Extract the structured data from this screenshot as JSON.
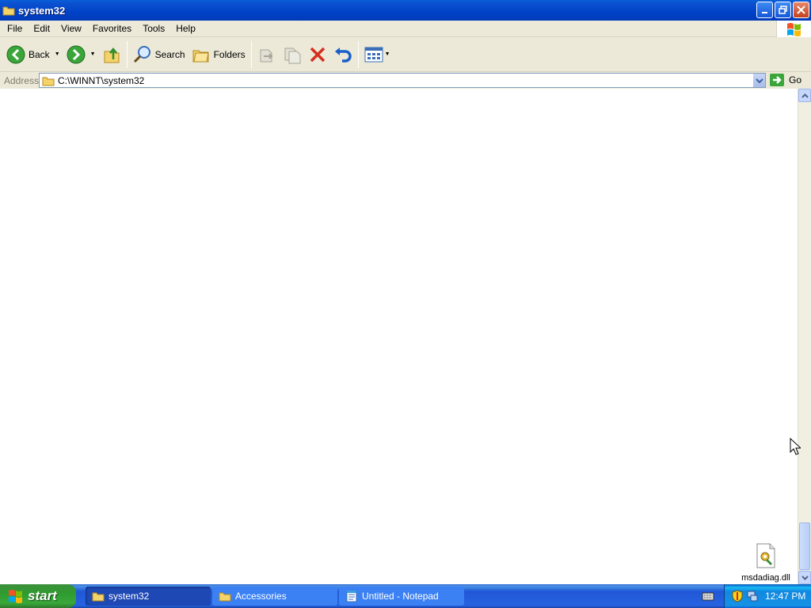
{
  "window": {
    "title": "system32"
  },
  "menubar": {
    "items": [
      "File",
      "Edit",
      "View",
      "Favorites",
      "Tools",
      "Help"
    ]
  },
  "toolbar": {
    "back_label": "Back",
    "search_label": "Search",
    "folders_label": "Folders"
  },
  "address": {
    "label": "Address",
    "value": "C:\\WINNT\\system32",
    "go_label": "Go"
  },
  "content": {
    "files": [
      {
        "name": "msdadiag.dll"
      }
    ]
  },
  "taskbar": {
    "start_label": "start",
    "tasks": [
      {
        "label": "system32"
      },
      {
        "label": "Accessories"
      },
      {
        "label": "Untitled - Notepad"
      }
    ],
    "clock": "12:47 PM"
  }
}
